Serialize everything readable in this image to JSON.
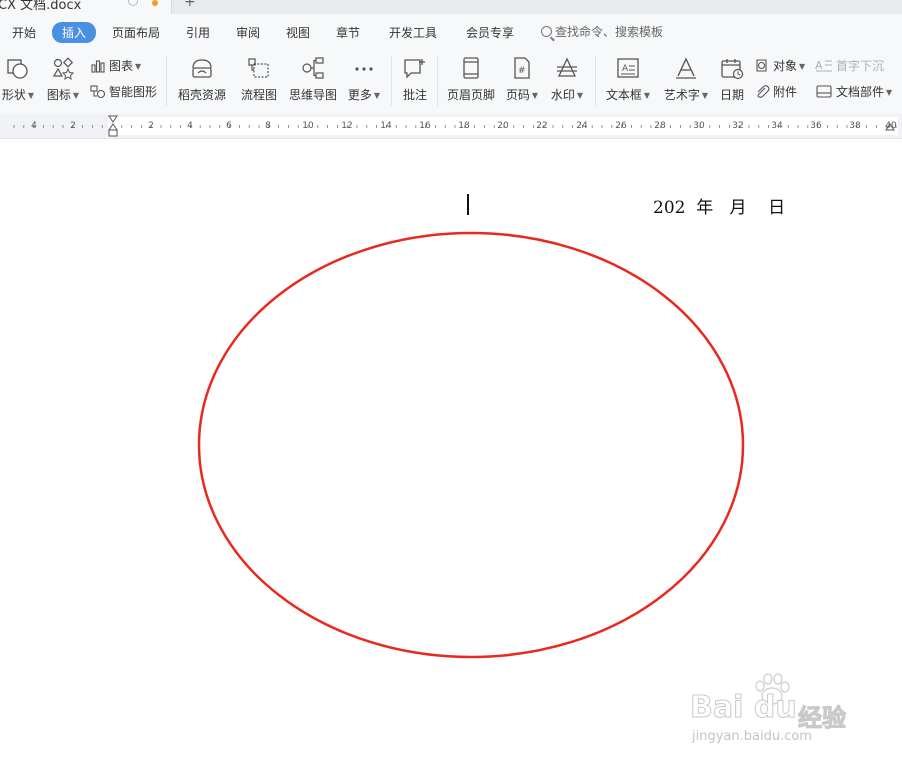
{
  "titlebar": {
    "doc_tab_label": "CX 文档.docx",
    "new_tab": "+"
  },
  "menu": {
    "items": [
      "开始",
      "插入",
      "页面布局",
      "引用",
      "审阅",
      "视图",
      "章节",
      "开发工具",
      "会员专享"
    ],
    "active": "插入",
    "search_placeholder": "查找命令、搜索模板"
  },
  "ribbon": {
    "shape": "形状",
    "icon": "图标",
    "chart": "图表",
    "smart_graphic": "智能图形",
    "docer_resources": "稻壳资源",
    "flowchart": "流程图",
    "mindmap": "思维导图",
    "more": "更多",
    "comment": "批注",
    "header_footer": "页眉页脚",
    "page_number": "页码",
    "watermark": "水印",
    "textbox": "文本框",
    "wordart": "艺术字",
    "date": "日期",
    "object": "对象",
    "attachment": "附件",
    "drop_cap": "首字下沉",
    "doc_parts": "文档部件"
  },
  "ruler": {
    "labels": [
      "4",
      "2",
      "2",
      "4",
      "6",
      "8",
      "10",
      "12",
      "14",
      "16",
      "18",
      "20",
      "22",
      "24",
      "26",
      "28",
      "30",
      "32",
      "34",
      "36",
      "38",
      "40"
    ]
  },
  "document": {
    "date_year": "202",
    "date_year_unit": "年",
    "date_month_unit": "月",
    "date_day_unit": "日",
    "ellipse_color": "#e8291f"
  },
  "watermark": {
    "brand": "Bai du",
    "brand_cn": "经验",
    "url": "jingyan.baidu.com"
  },
  "colors": {
    "accent": "#4a90e2",
    "ribbon_bg": "#f7f8fa",
    "ellipse": "#e8291f"
  }
}
